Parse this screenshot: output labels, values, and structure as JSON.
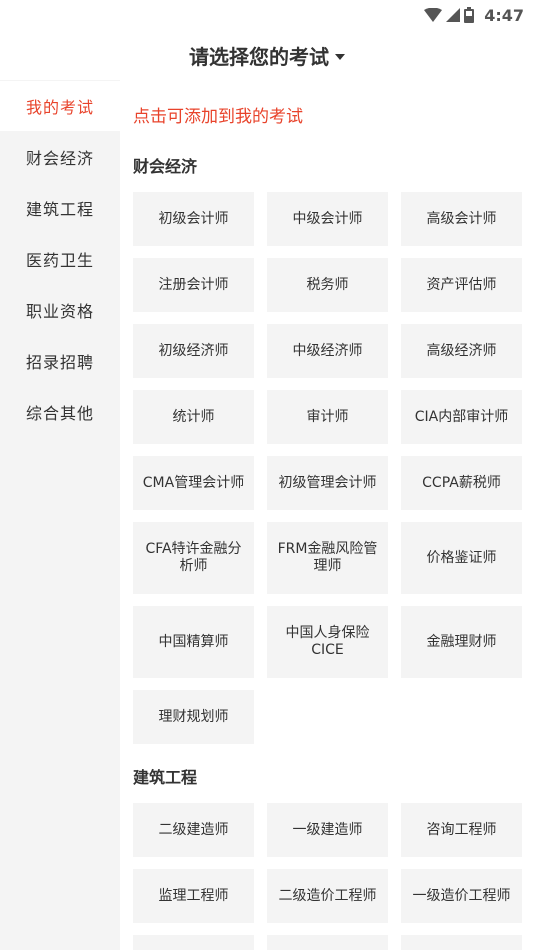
{
  "status_bar": {
    "time": "4:47",
    "icons": [
      "wifi-icon",
      "signal-icon",
      "battery-icon"
    ]
  },
  "header": {
    "title": "请选择您的考试",
    "dropdown_icon": "caret-down-icon"
  },
  "colors": {
    "accent": "#e8432b",
    "chip_bg": "#f4f4f4",
    "sidebar_bg": "#f4f4f4",
    "text": "#333333"
  },
  "sidebar": {
    "items": [
      {
        "label": "我的考试",
        "active": true
      },
      {
        "label": "财会经济",
        "active": false
      },
      {
        "label": "建筑工程",
        "active": false
      },
      {
        "label": "医药卫生",
        "active": false
      },
      {
        "label": "职业资格",
        "active": false
      },
      {
        "label": "招录招聘",
        "active": false
      },
      {
        "label": "综合其他",
        "active": false
      }
    ]
  },
  "main": {
    "hint": "点击可添加到我的考试",
    "sections": [
      {
        "title": "财会经济",
        "items": [
          "初级会计师",
          "中级会计师",
          "高级会计师",
          "注册会计师",
          "税务师",
          "资产评估师",
          "初级经济师",
          "中级经济师",
          "高级经济师",
          "统计师",
          "审计师",
          "CIA内部审计师",
          "CMA管理会计师",
          "初级管理会计师",
          "CCPA薪税师",
          "CFA特许金融分析师",
          "FRM金融风险管理师",
          "价格鉴证师",
          "中国精算师",
          "中国人身保险CICE",
          "金融理财师",
          "理财规划师"
        ]
      },
      {
        "title": "建筑工程",
        "items": [
          "二级建造师",
          "一级建造师",
          "咨询工程师",
          "监理工程师",
          "二级造价工程师",
          "一级造价工程师",
          "",
          "",
          ""
        ]
      }
    ]
  }
}
